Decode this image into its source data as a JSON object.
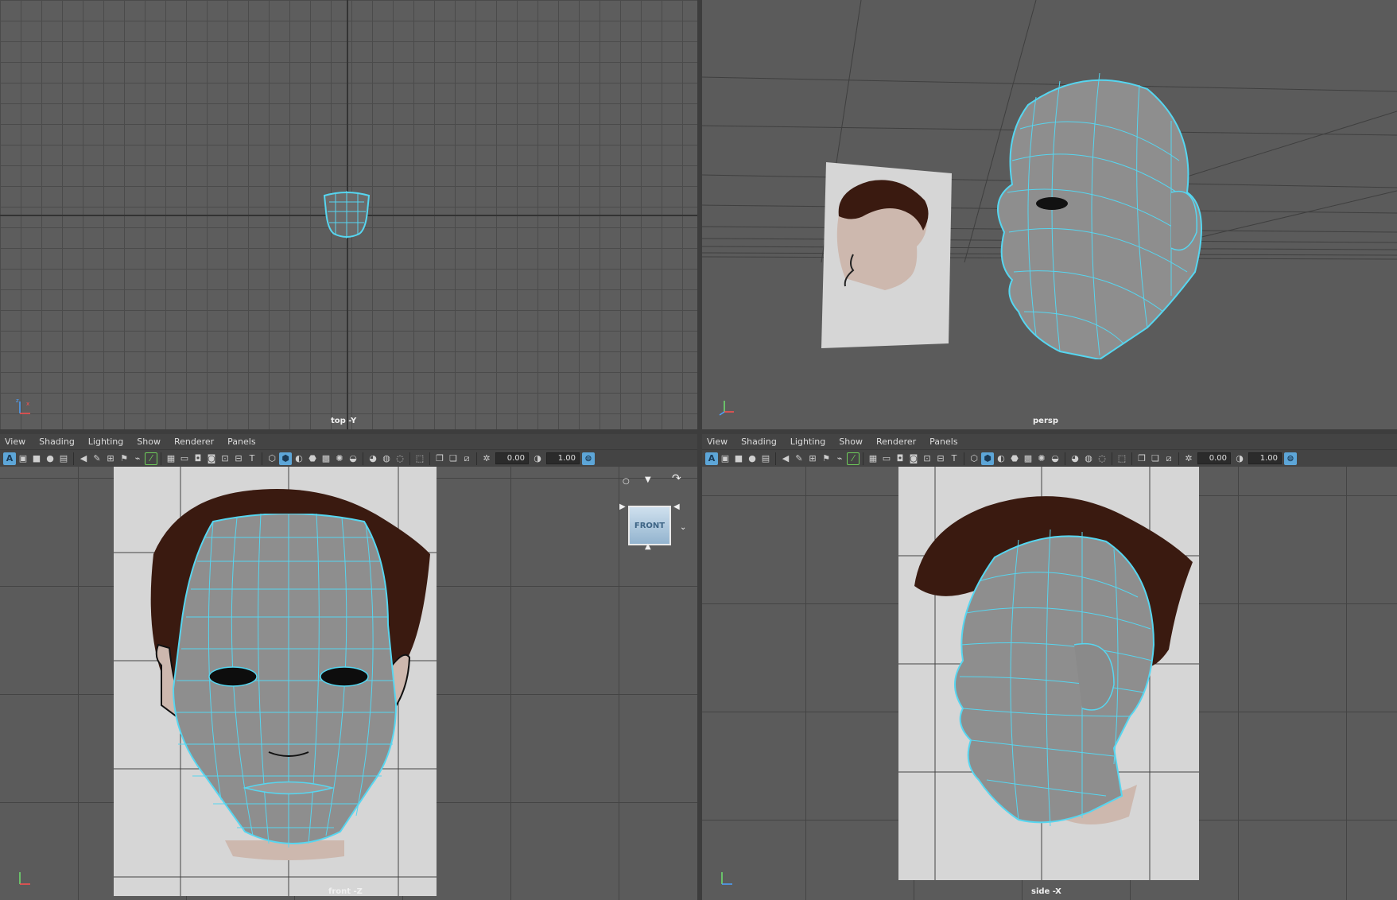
{
  "viewports": {
    "top": {
      "camera": "top -Y"
    },
    "persp": {
      "camera": "persp"
    },
    "front": {
      "camera": "front -Z"
    },
    "side": {
      "camera": "side -X"
    }
  },
  "panel_menu": [
    "View",
    "Shading",
    "Lighting",
    "Show",
    "Renderer",
    "Panels"
  ],
  "toolbar": {
    "exposure": "0.00",
    "gamma": "1.00"
  },
  "viewcube": {
    "label": "FRONT"
  },
  "colors": {
    "wireframe": "#56d6f0",
    "mesh": "#8e8e8e",
    "background": "#5b5b5b",
    "hair": "#3a1a10",
    "skin": "#cdb8ae",
    "card": "#d6d6d6"
  },
  "icons": [
    "select-camera-icon",
    "film-gate-icon",
    "grid-icon",
    "wireframe-icon",
    "smooth-shade-icon",
    "texture-icon",
    "light-icon",
    "isolate-icon",
    "xray-icon",
    "exposure-icon",
    "gamma-icon",
    "colorspace-icon"
  ]
}
